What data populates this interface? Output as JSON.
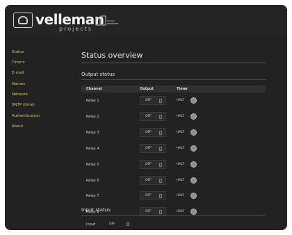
{
  "logo": {
    "brand": "velleman",
    "sub": "projects"
  },
  "sidebar": {
    "items": [
      {
        "label": "Status"
      },
      {
        "label": "Timers"
      },
      {
        "label": "E-mail"
      },
      {
        "label": "Names"
      },
      {
        "label": "Network"
      },
      {
        "label": "SNTP (time)"
      },
      {
        "label": "Authentication"
      },
      {
        "label": "About"
      }
    ]
  },
  "main": {
    "title": "Status overview",
    "output_section": "Output status",
    "columns": {
      "channel": "Channel",
      "output": "Output",
      "timer": "Timer"
    },
    "relays": [
      {
        "label": "Relay 1",
        "output": "OFF",
        "timer": "HALT"
      },
      {
        "label": "Relay 2",
        "output": "OFF",
        "timer": "HALT"
      },
      {
        "label": "Relay 3",
        "output": "OFF",
        "timer": "HALT"
      },
      {
        "label": "Relay 4",
        "output": "OFF",
        "timer": "HALT"
      },
      {
        "label": "Relay 5",
        "output": "OFF",
        "timer": "HALT"
      },
      {
        "label": "Relay 6",
        "output": "OFF",
        "timer": "HALT"
      },
      {
        "label": "Relay 7",
        "output": "OFF",
        "timer": "HALT"
      },
      {
        "label": "Relay 8",
        "output": "OFF",
        "timer": "HALT"
      }
    ],
    "input_section": "Input status",
    "input": {
      "label": "Input",
      "state": "OFF"
    }
  },
  "colors": {
    "background": "#222222",
    "nav_link": "#d9c85a",
    "text": "#e6e6e6"
  }
}
